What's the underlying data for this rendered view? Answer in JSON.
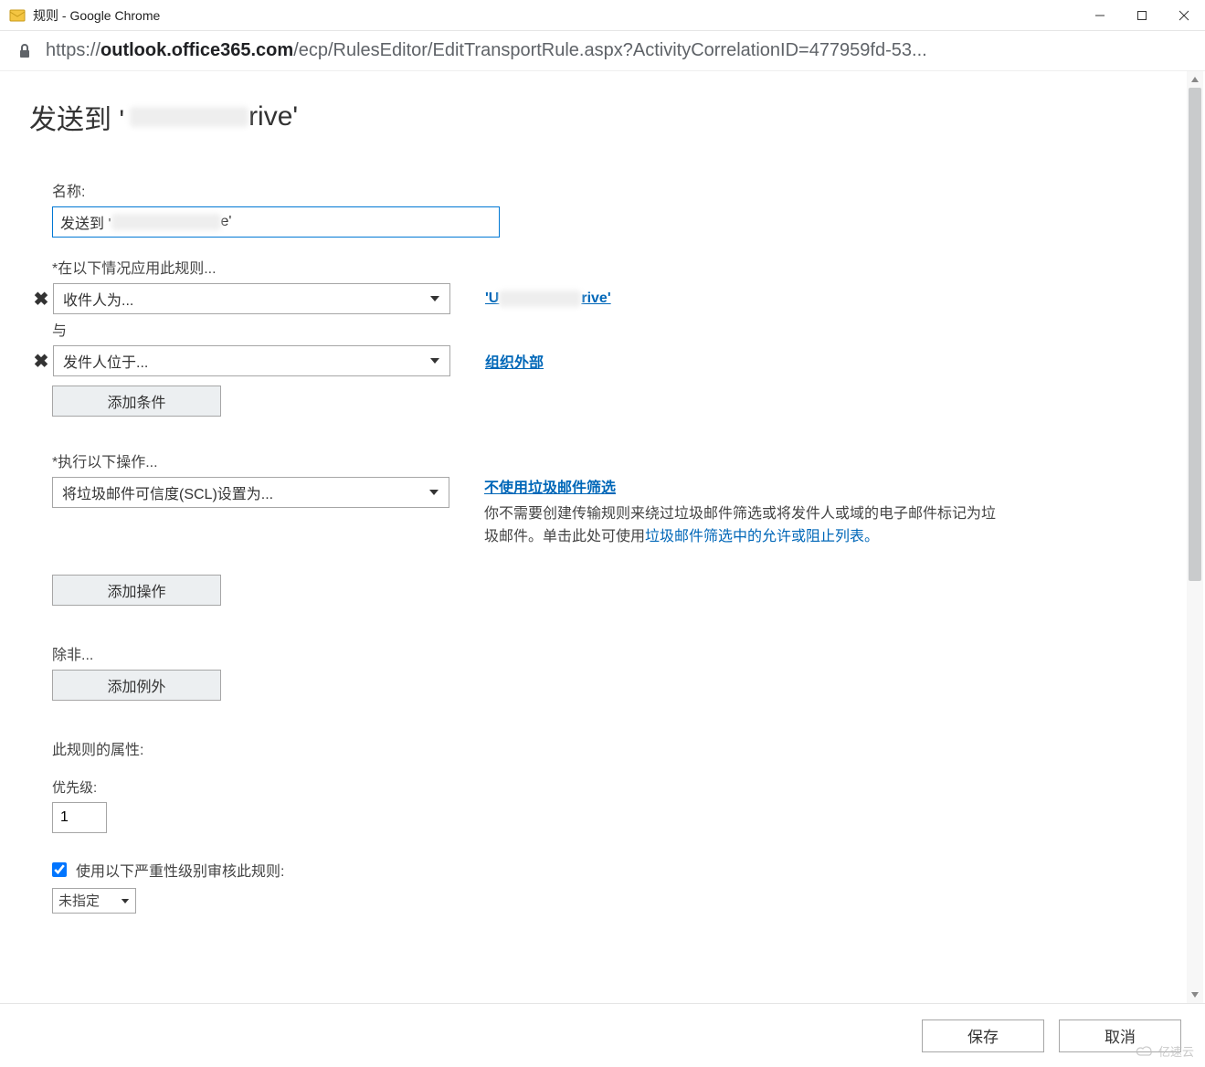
{
  "window": {
    "title": "规则 - Google Chrome",
    "url_host": "outlook.office365.com",
    "url_path": "/ecp/RulesEditor/EditTransportRule.aspx?ActivityCorrelationID=477959fd-53..."
  },
  "page": {
    "title_prefix": "发送到 '",
    "title_suffix": "rive'"
  },
  "form": {
    "name_label": "名称:",
    "name_value_prefix": "发送到 '",
    "name_value_suffix": "e'",
    "apply_label": "*在以下情况应用此规则...",
    "condition1": {
      "select": "收件人为...",
      "value_prefix": "'U",
      "value_suffix": "rive'"
    },
    "and_label": "与",
    "condition2": {
      "select": "发件人位于...",
      "value": "组织外部"
    },
    "add_condition_btn": "添加条件",
    "action_label": "*执行以下操作...",
    "action_select": "将垃圾邮件可信度(SCL)设置为...",
    "action_header": "不使用垃圾邮件筛选",
    "action_text_1": "你不需要创建传输规则来绕过垃圾邮件筛选或将发件人或域的电子邮件标记为垃圾邮件。单击此处可使用",
    "action_link": "垃圾邮件筛选中的允许或阻止列表。",
    "add_action_btn": "添加操作",
    "except_label": "除非...",
    "add_exception_btn": "添加例外",
    "properties_label": "此规则的属性:",
    "priority_label": "优先级:",
    "priority_value": "1",
    "audit_chk_label": "使用以下严重性级别审核此规则:",
    "audit_chk_checked": true,
    "severity_value": "未指定"
  },
  "buttons": {
    "save": "保存",
    "cancel": "取消"
  },
  "watermark": "亿速云"
}
